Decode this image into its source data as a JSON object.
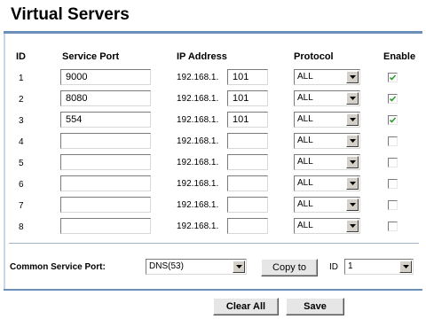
{
  "page": {
    "title": "Virtual Servers"
  },
  "table": {
    "headers": {
      "id": "ID",
      "service_port": "Service Port",
      "ip_address": "IP Address",
      "protocol": "Protocol",
      "enable": "Enable"
    },
    "ip_prefix": "192.168.1.",
    "rows": [
      {
        "id": "1",
        "port": "9000",
        "ip_octet": "101",
        "protocol": "ALL",
        "enabled": true
      },
      {
        "id": "2",
        "port": "8080",
        "ip_octet": "101",
        "protocol": "ALL",
        "enabled": true
      },
      {
        "id": "3",
        "port": "554",
        "ip_octet": "101",
        "protocol": "ALL",
        "enabled": true
      },
      {
        "id": "4",
        "port": "",
        "ip_octet": "",
        "protocol": "ALL",
        "enabled": false
      },
      {
        "id": "5",
        "port": "",
        "ip_octet": "",
        "protocol": "ALL",
        "enabled": false
      },
      {
        "id": "6",
        "port": "",
        "ip_octet": "",
        "protocol": "ALL",
        "enabled": false
      },
      {
        "id": "7",
        "port": "",
        "ip_octet": "",
        "protocol": "ALL",
        "enabled": false
      },
      {
        "id": "8",
        "port": "",
        "ip_octet": "",
        "protocol": "ALL",
        "enabled": false
      }
    ]
  },
  "common_service": {
    "label": "Common Service Port:",
    "selected": "DNS(53)",
    "copy_button": "Copy to",
    "id_label": "ID",
    "id_selected": "1"
  },
  "footer": {
    "clear_all": "Clear All",
    "save": "Save"
  },
  "colors": {
    "accent_rule": "#6b8fb9",
    "check": "#2e9b2e"
  },
  "icons": {
    "dropdown": "chevron-down-icon",
    "checkmark": "checkmark-icon"
  }
}
